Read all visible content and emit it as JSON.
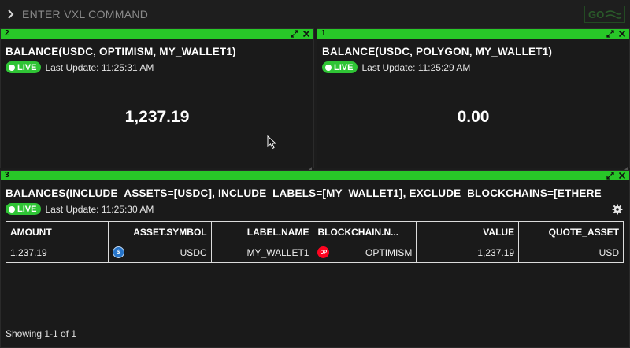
{
  "command_bar": {
    "placeholder": "ENTER VXL COMMAND",
    "caret_icon": "chevron-right-icon",
    "logo": "GO"
  },
  "colors": {
    "accent_green": "#28c828",
    "live_green": "#2fc435",
    "background": "#1c1c1c",
    "usdc_blue": "#2775ca",
    "optimism_red": "#ff0420"
  },
  "panels": {
    "left": {
      "number": "2",
      "title": "BALANCE(USDC, OPTIMISM, MY_WALLET1)",
      "live_label": "LIVE",
      "last_update": "Last Update: 11:25:31 AM",
      "value": "1,237.19"
    },
    "right": {
      "number": "1",
      "title": "BALANCE(USDC, POLYGON, MY_WALLET1)",
      "live_label": "LIVE",
      "last_update": "Last Update: 11:25:29 AM",
      "value": "0.00"
    },
    "bottom": {
      "number": "3",
      "title": "BALANCES(INCLUDE_ASSETS=[USDC], INCLUDE_LABELS=[MY_WALLET1], EXCLUDE_BLOCKCHAINS=[ETHERE",
      "live_label": "LIVE",
      "last_update": "Last Update: 11:25:30 AM",
      "table": {
        "headers": [
          "AMOUNT",
          "ASSET.SYMBOL",
          "LABEL.NAME",
          "BLOCKCHAIN.N...",
          "VALUE",
          "QUOTE_ASSET"
        ],
        "rows": [
          [
            "1,237.19",
            "USDC",
            "MY_WALLET1",
            "OPTIMISM",
            "1,237.19",
            "USD"
          ]
        ]
      },
      "footer": "Showing 1-1 of 1"
    }
  }
}
